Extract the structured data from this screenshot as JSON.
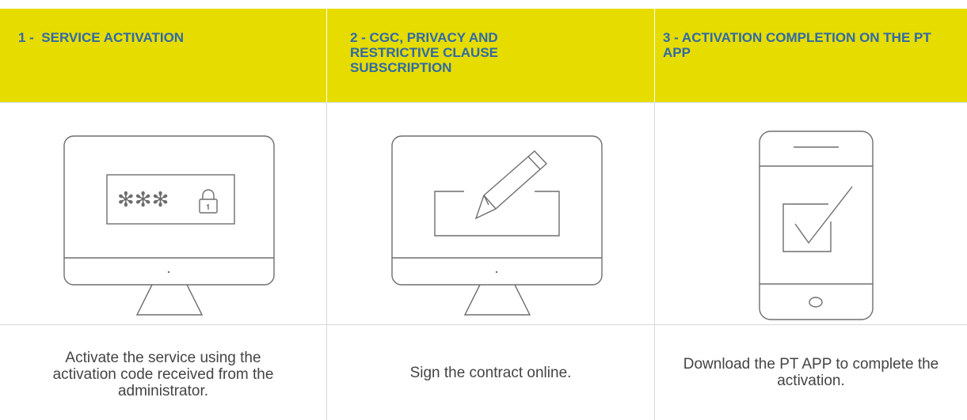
{
  "steps": [
    {
      "title": "1 -  SERVICE ACTIVATION",
      "illustration": "monitor-password-lock-icon",
      "description": "Activate the service using the activation code received from the administrator.",
      "password_mask": "✻✻✻"
    },
    {
      "title": "2 - CGC, PRIVACY AND RESTRICTIVE CLAUSE SUBSCRIPTION",
      "illustration": "monitor-pencil-sign-icon",
      "description": "Sign the contract online."
    },
    {
      "title": "3 - ACTIVATION COMPLETION ON THE PT APP",
      "illustration": "smartphone-checkbox-icon",
      "description": "Download the PT APP to complete the activation."
    }
  ],
  "colors": {
    "header_bg": "#e6dc00",
    "header_text": "#2f6aa8",
    "body_text": "#444444",
    "icon_stroke": "#6e6e6e",
    "divider": "#d9d9d9"
  }
}
